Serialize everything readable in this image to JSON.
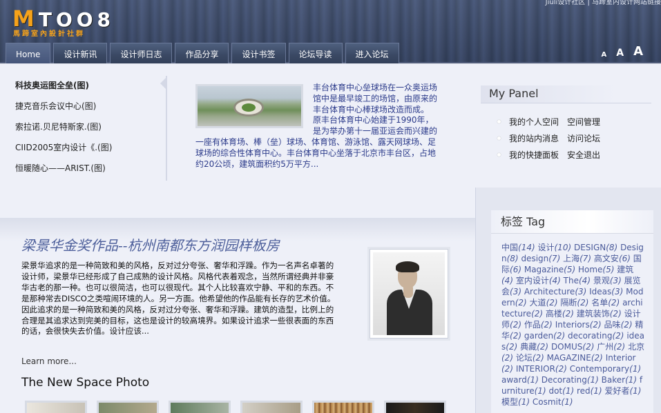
{
  "header": {
    "logo_text": "TOO8",
    "logo_m": "M",
    "logo_sub": "馬蹄室內設計社群",
    "top_link": "Jiuli设计社区 | 马蹄室内设计网站链接",
    "font_sizes": [
      "A",
      "A",
      "A"
    ]
  },
  "nav": [
    "Home",
    "设计新讯",
    "设计师日志",
    "作品分享",
    "设计书签",
    "论坛导读",
    "进入论坛"
  ],
  "featured": {
    "list": [
      "科技奥运图全垒(图)",
      "捷克音乐会议中心(图)",
      "索拉诺.贝尼特斯家.(图)",
      "CIID2005室内设计《.(图)",
      "恒暖随心——ARIST.(图)"
    ],
    "text": "丰台体育中心垒球场在一众奥运场馆中是最早竣工的场馆，由原来的丰台体育中心棒球场改造而成。 原丰台体育中心始建于1990年，是为举办第十一届亚运会而兴建的一座有体育场、棒（垒）球场、体育馆、游泳馆、露天网球场、足球场的综合性体育中心。丰台体育中心坐落于北京市丰台区，占地约20公顷，建筑面积约5万平方..."
  },
  "my_panel": {
    "title": "My Panel",
    "rows": [
      [
        "我的个人空间",
        "空间管理"
      ],
      [
        "我的站内消息",
        "访问论坛"
      ],
      [
        "我的快捷面板",
        "安全退出"
      ]
    ]
  },
  "article": {
    "title": "梁景华金奖作品--杭州南都东方润园样板房",
    "body": "梁景华追求的是一种简致和美的风格，反对过分夸张、奢华和浮躁。作为一名声名卓著的设计师，梁景华已经形成了自己成熟的设计风格。风格代表着观念，当然所谓经典并非豪华古老的那一种。也可以很简洁，也可以很现代。其个人比较喜欢宁静、平和的东西。不是那种常去DISCO之类喧闹环境的人。另一方面。他希望他的作品能有长存的艺术价值。因此追求的是一种简致和美的风格，反对过分夸张、奢华和浮躁。建筑的造型，比例上的合理是其追求达到完美的目标，这也是设计的较高境界。如果设计追求一些很表面的东西的话，会很快失去价值。设计应该...",
    "learn_more": "Learn more...",
    "section_title": "The New Space Photo"
  },
  "tags": {
    "title": "标签 Tag",
    "items": [
      [
        "中国",
        "(14)"
      ],
      [
        "设计",
        "(10)"
      ],
      [
        "DESIGN",
        "(8)"
      ],
      [
        "Design",
        "(8)"
      ],
      [
        "design",
        "(7)"
      ],
      [
        "上海",
        "(7)"
      ],
      [
        "高文安",
        "(6)"
      ],
      [
        "国际",
        "(6)"
      ],
      [
        "Magazine",
        "(5)"
      ],
      [
        "Home",
        "(5)"
      ],
      [
        "建筑",
        "(4)"
      ],
      [
        "室内设计",
        "(4)"
      ],
      [
        "The",
        "(4)"
      ],
      [
        "景观",
        "(3)"
      ],
      [
        "展览会",
        "(3)"
      ],
      [
        "Architecture",
        "(3)"
      ],
      [
        "Ideas",
        "(3)"
      ],
      [
        "Modern",
        "(2)"
      ],
      [
        "大道",
        "(2)"
      ],
      [
        "隔断",
        "(2)"
      ],
      [
        "名单",
        "(2)"
      ],
      [
        "architecture",
        "(2)"
      ],
      [
        "高楼",
        "(2)"
      ],
      [
        "建筑装饰",
        "(2)"
      ],
      [
        "设计师",
        "(2)"
      ],
      [
        "作品",
        "(2)"
      ],
      [
        "Interiors",
        "(2)"
      ],
      [
        "品味",
        "(2)"
      ],
      [
        "精华",
        "(2)"
      ],
      [
        "garden",
        "(2)"
      ],
      [
        "decorating",
        "(2)"
      ],
      [
        "ideas",
        "(2)"
      ],
      [
        "典藏",
        "(2)"
      ],
      [
        "DOMUS",
        "(2)"
      ],
      [
        "广州",
        "(2)"
      ],
      [
        "北京",
        "(2)"
      ],
      [
        "论坛",
        "(2)"
      ],
      [
        "MAGAZINE",
        "(2)"
      ],
      [
        "Interior",
        "(2)"
      ],
      [
        "INTERIOR",
        "(2)"
      ],
      [
        "Contemporary",
        "(1)"
      ],
      [
        "award",
        "(1)"
      ],
      [
        "Decorating",
        "(1)"
      ],
      [
        "Baker",
        "(1)"
      ],
      [
        "furniture",
        "(1)"
      ],
      [
        "dot",
        "(1)"
      ],
      [
        "red",
        "(1)"
      ],
      [
        "爱好者",
        "(1)"
      ],
      [
        "模型",
        "(1)"
      ],
      [
        "Cosmit",
        "(1)"
      ]
    ]
  }
}
